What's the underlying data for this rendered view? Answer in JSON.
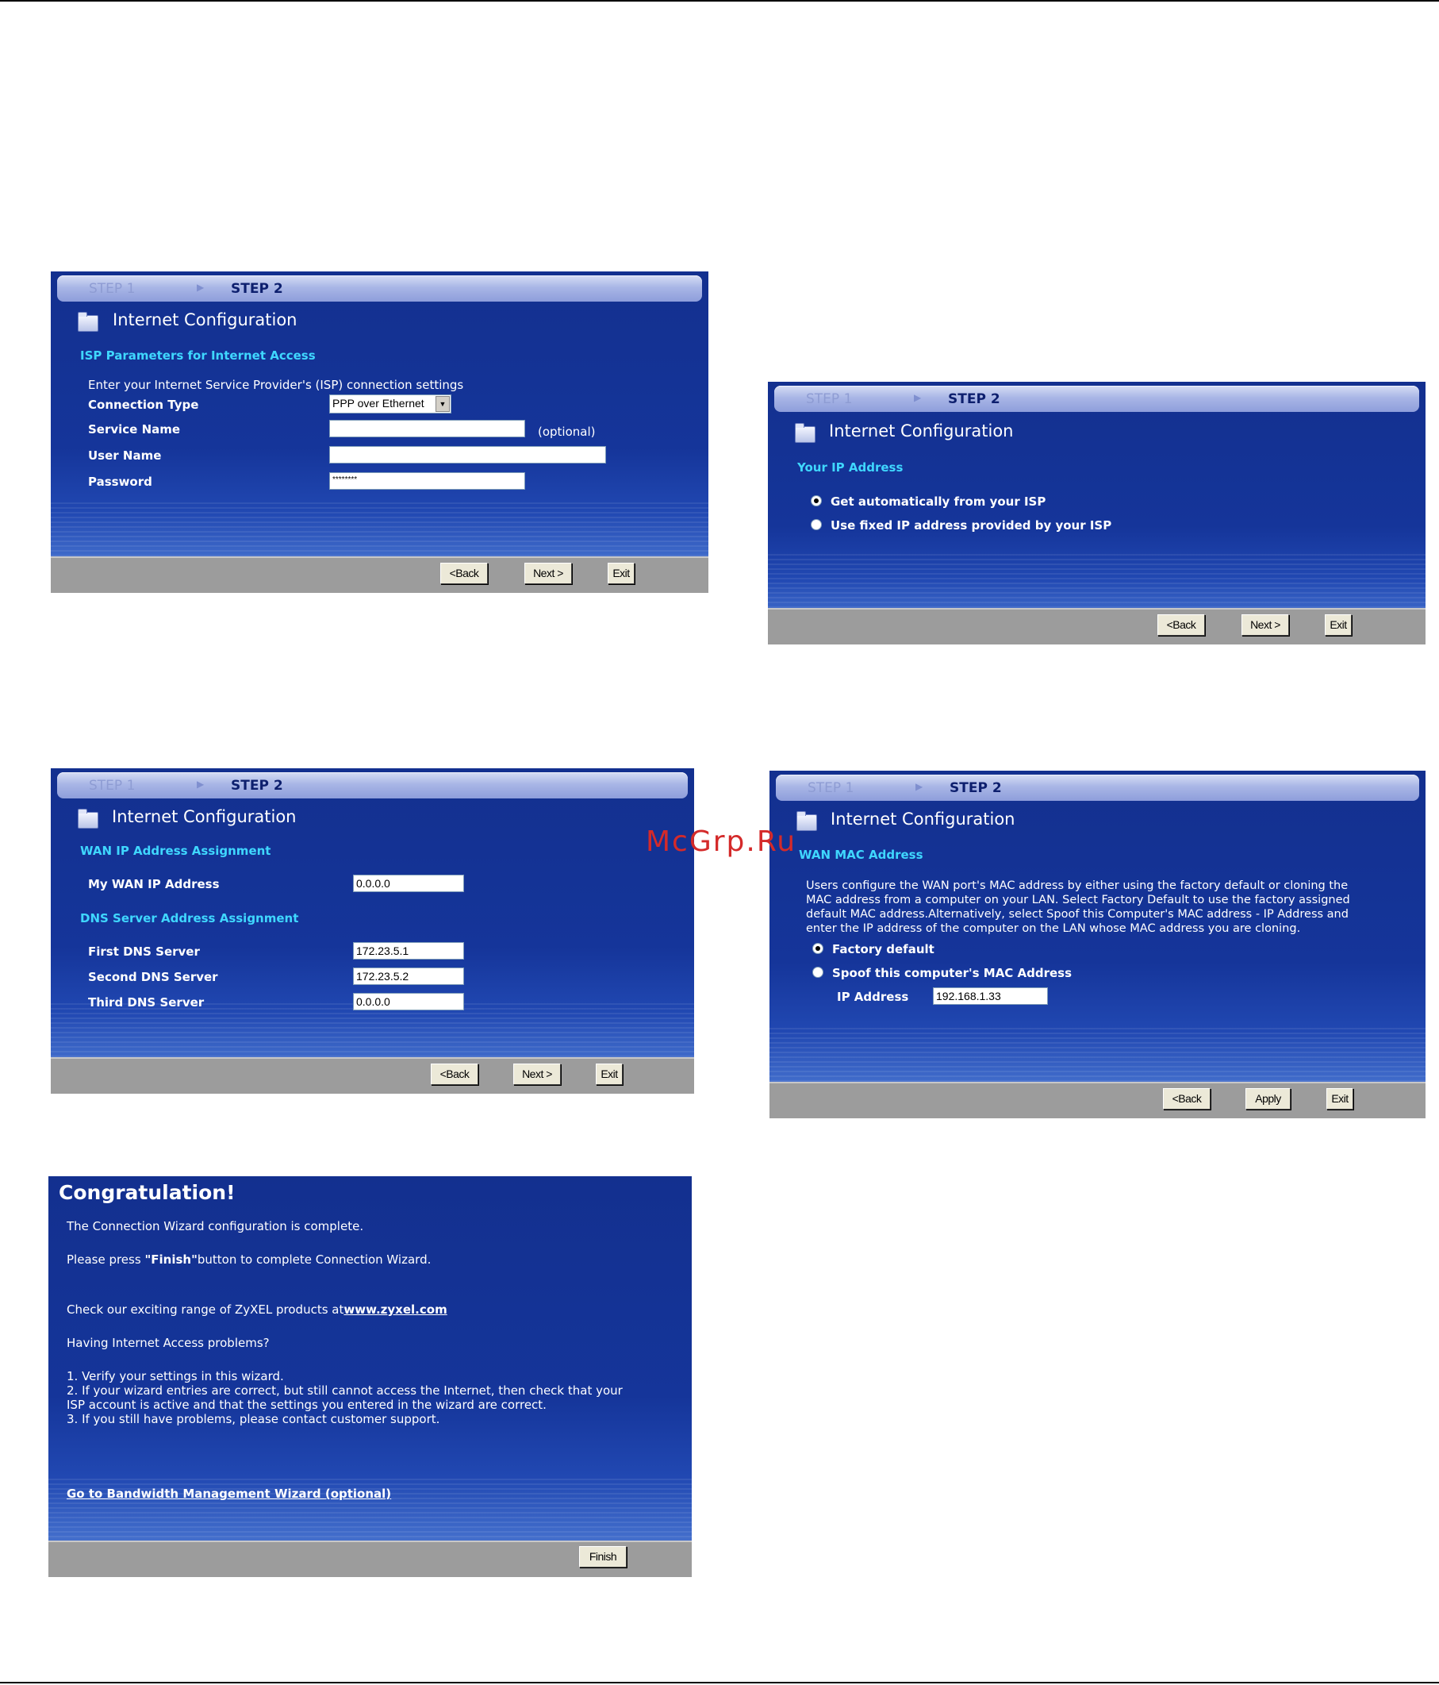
{
  "wizard": {
    "step1": "STEP 1",
    "step2": "STEP 2",
    "title": "Internet Configuration",
    "back": "<Back",
    "next": "Next >",
    "exit": "Exit",
    "apply": "Apply",
    "finish": "Finish"
  },
  "panel_isp": {
    "section": "ISP Parameters for Internet Access",
    "intro": "Enter your Internet Service Provider's (ISP) connection settings",
    "connection_type_label": "Connection Type",
    "connection_type_value": "PPP over Ethernet",
    "service_name_label": "Service Name",
    "service_name_value": "",
    "optional": "(optional)",
    "user_name_label": "User Name",
    "user_name_value": "",
    "password_label": "Password",
    "password_value": "********"
  },
  "panel_ip": {
    "section": "Your IP Address",
    "option_auto": "Get automatically from your ISP",
    "option_fixed": "Use fixed IP address provided by your ISP",
    "selected": "auto"
  },
  "panel_wan": {
    "section_wan": "WAN IP Address Assignment",
    "my_wan_ip_label": "My WAN IP Address",
    "my_wan_ip_value": "0.0.0.0",
    "section_dns": "DNS Server Address Assignment",
    "first_dns_label": "First DNS Server",
    "first_dns_value": "172.23.5.1",
    "second_dns_label": "Second DNS Server",
    "second_dns_value": "172.23.5.2",
    "third_dns_label": "Third DNS Server",
    "third_dns_value": "0.0.0.0"
  },
  "panel_mac": {
    "section": "WAN MAC Address",
    "description": [
      "Users configure the WAN port's MAC address by either using the factory default or cloning the",
      "MAC address from a computer on your LAN. Select Factory Default to use the factory assigned",
      "default MAC address.Alternatively, select Spoof this Computer's MAC address - IP Address and",
      "enter the IP address of the computer on the LAN whose MAC address you are cloning."
    ],
    "option_factory": "Factory default",
    "option_spoof": "Spoof this computer's MAC Address",
    "ip_label": "IP Address",
    "ip_value": "192.168.1.33",
    "selected": "factory"
  },
  "panel_done": {
    "title": "Congratulation!",
    "line1": "The Connection Wizard configuration is complete.",
    "line2_prefix": "Please press ",
    "line2_bold": "\"Finish\"",
    "line2_suffix": "button to complete Connection Wizard.",
    "line3_prefix": "Check our exciting range of ZyXEL products at",
    "line3_link": "www.zyxel.com",
    "line4": "Having Internet Access problems?",
    "steps": [
      "1. Verify your settings in this wizard.",
      "2. If your wizard entries are correct, but still cannot access the Internet, then check that your",
      "ISP account is active and that the settings you entered in the wizard are correct.",
      "3. If you still have problems, please contact customer support."
    ],
    "bandwidth_link": "Go to Bandwidth Management Wizard (optional)"
  },
  "watermark": "McGrp.Ru"
}
